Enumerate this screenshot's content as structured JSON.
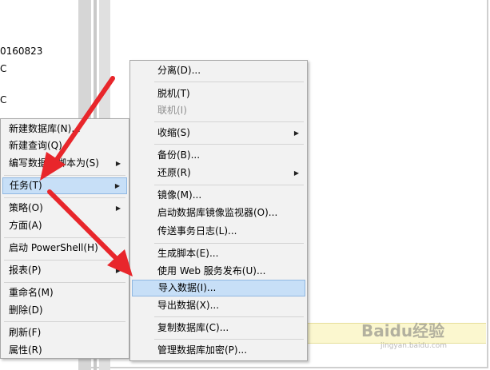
{
  "tree": {
    "lines": [
      "0160823",
      "C",
      "C"
    ]
  },
  "context_menu": {
    "items": [
      {
        "label": "新建数据库(N)..."
      },
      {
        "label": "新建查询(Q)"
      },
      {
        "label": "编写数据库脚本为(S)",
        "submenu": true
      },
      {
        "label": "任务(T)",
        "submenu": true,
        "highlighted": true
      },
      {
        "label": "策略(O)",
        "submenu": true
      },
      {
        "label": "方面(A)"
      },
      {
        "label": "启动 PowerShell(H)"
      },
      {
        "label": "报表(P)",
        "submenu": true
      },
      {
        "label": "重命名(M)"
      },
      {
        "label": "删除(D)"
      },
      {
        "label": "刷新(F)"
      },
      {
        "label": "属性(R)"
      }
    ]
  },
  "tasks_menu": {
    "items": [
      {
        "label": "分离(D)..."
      },
      {
        "label": "脱机(T)"
      },
      {
        "label": "联机(I)",
        "disabled": true
      },
      {
        "label": "收缩(S)",
        "submenu": true
      },
      {
        "label": "备份(B)..."
      },
      {
        "label": "还原(R)",
        "submenu": true
      },
      {
        "label": "镜像(M)..."
      },
      {
        "label": "启动数据库镜像监视器(O)..."
      },
      {
        "label": "传送事务日志(L)..."
      },
      {
        "label": "生成脚本(E)..."
      },
      {
        "label": "使用 Web 服务发布(U)..."
      },
      {
        "label": "导入数据(I)...",
        "highlighted": true
      },
      {
        "label": "导出数据(X)..."
      },
      {
        "label": "复制数据库(C)..."
      },
      {
        "label": "管理数据库加密(P)..."
      }
    ]
  },
  "watermark": {
    "brand": "Baidu经验",
    "url": "jingyan.baidu.com"
  },
  "colors": {
    "highlight": "#c7dff7",
    "menu_bg": "#f2f2f2",
    "arrow": "#e8262b"
  }
}
